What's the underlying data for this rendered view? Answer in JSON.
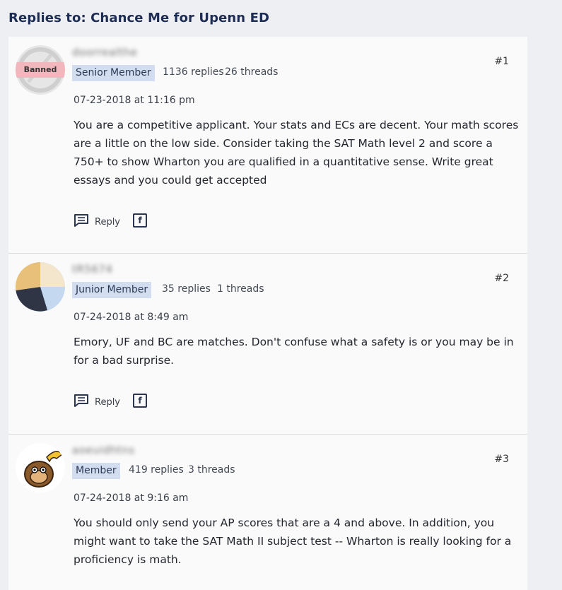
{
  "page": {
    "title": "Replies to: Chance Me for Upenn ED"
  },
  "posts": [
    {
      "username": "doorrealthe",
      "role": "Senior Member",
      "replies": "1136 replies",
      "threads": "26 threads",
      "number": "#1",
      "timestamp": "07-23-2018 at 11:16 pm",
      "body": "You are a competitive applicant. Your stats and ECs are decent. Your math scores are a little on the low side. Consider taking the SAT Math level 2 and score a 750+ to show Wharton you are qualified in a quantitative sense. Write great essays and you could get accepted",
      "banned_label": "Banned",
      "reply_label": "Reply",
      "fb_label": "f"
    },
    {
      "username": "tR5674",
      "role": "Junior Member",
      "replies": "35 replies",
      "threads": "1 threads",
      "number": "#2",
      "timestamp": "07-24-2018 at 8:49 am",
      "body": "Emory, UF and BC are matches. Don't confuse what a safety is or you may be in for a bad surprise.",
      "reply_label": "Reply",
      "fb_label": "f"
    },
    {
      "username": "aoeuidhtns",
      "role": "Member",
      "replies": "419 replies",
      "threads": "3 threads",
      "number": "#3",
      "timestamp": "07-24-2018 at 9:16 am",
      "body": "You should only send your AP scores that are a 4 and above. In addition, you might want to take the SAT Math II subject test -- Wharton is really looking for a proficiency is math."
    }
  ],
  "icons": {
    "reply": "comment-icon",
    "facebook": "facebook-icon"
  },
  "colors": {
    "title": "#1e2d54",
    "badge_bg": "#d2def0",
    "banned_bg": "#f2b6bd",
    "page_bg": "#eeeff3",
    "card_bg": "#fafafb"
  }
}
